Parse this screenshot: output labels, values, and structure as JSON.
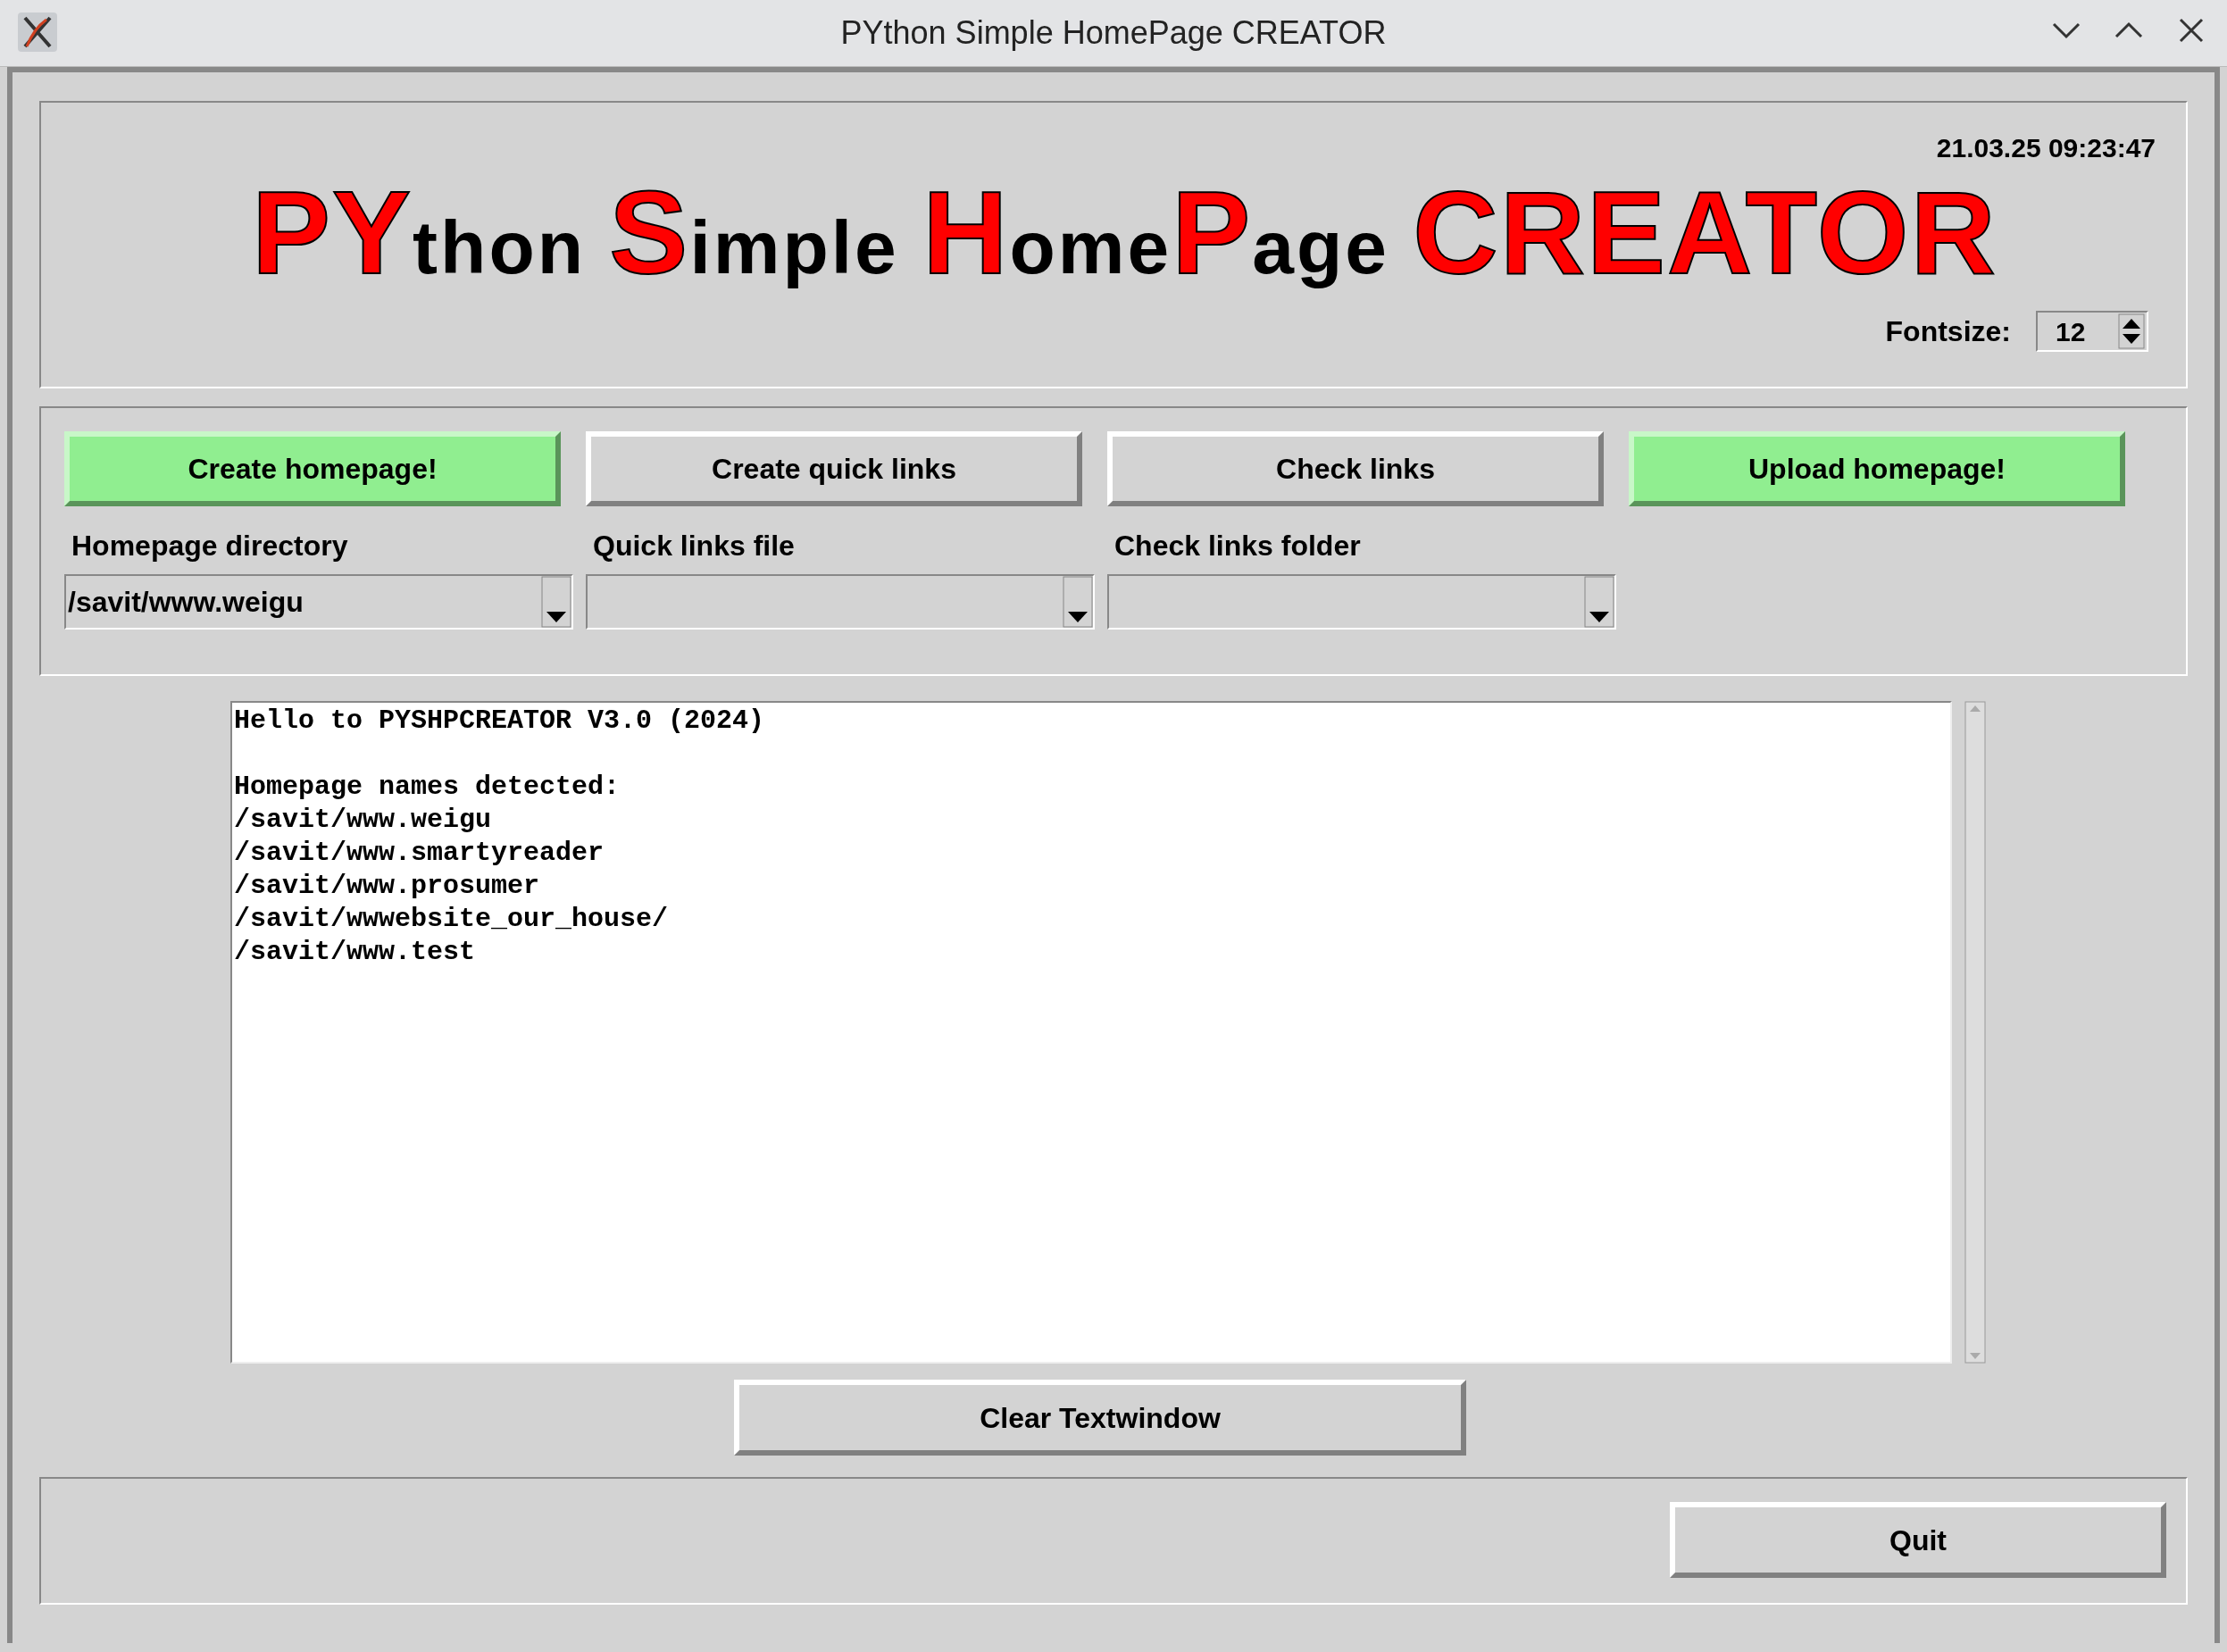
{
  "window": {
    "title": "PYthon Simple HomePage CREATOR"
  },
  "header": {
    "datetime": "21.03.25 09:23:47",
    "logo": [
      {
        "text": "PY",
        "kind": "big"
      },
      {
        "text": "thon ",
        "kind": "small"
      },
      {
        "text": "S",
        "kind": "big"
      },
      {
        "text": "imple ",
        "kind": "small"
      },
      {
        "text": "H",
        "kind": "big"
      },
      {
        "text": "ome",
        "kind": "small"
      },
      {
        "text": "P",
        "kind": "big"
      },
      {
        "text": "age ",
        "kind": "small"
      },
      {
        "text": "CREATOR",
        "kind": "big"
      }
    ],
    "fontsize": {
      "label": "Fontsize:",
      "value": "12"
    }
  },
  "actions": [
    {
      "label": "Create homepage!",
      "kind": "primary",
      "field_label": "Homepage directory",
      "field_value": "/savit/www.weigu"
    },
    {
      "label": "Create quick links",
      "kind": "normal",
      "field_label": "Quick links file"
    },
    {
      "label": "Check links",
      "kind": "normal",
      "field_label": "Check links folder"
    },
    {
      "label": "Upload homepage!",
      "kind": "primary"
    }
  ],
  "text_window": {
    "paragraphs": [
      [
        "Hello to PYSHPCREATOR V3.0 (2024)"
      ],
      [
        "Homepage names detected:",
        "/savit/www.weigu",
        "/savit/www.smartyreader",
        "/savit/www.prosumer",
        "/savit/wwwebsite_our_house/",
        "/savit/www.test"
      ]
    ]
  },
  "clear_button": "Clear Textwindow",
  "quit_button": "Quit"
}
